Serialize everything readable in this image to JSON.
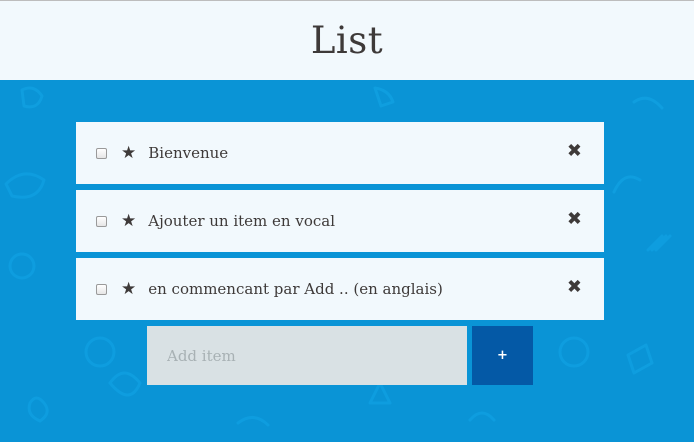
{
  "header": {
    "title": "List"
  },
  "items": [
    {
      "label": "Bienvenue",
      "checked": false,
      "starred": true,
      "remove_icon": "close-icon"
    },
    {
      "label": "Ajouter un item en vocal",
      "checked": false,
      "starred": true,
      "remove_icon": "close-icon"
    },
    {
      "label": "en commencant par Add .. (en anglais)",
      "checked": false,
      "starred": true,
      "remove_icon": "close-icon"
    }
  ],
  "add_form": {
    "placeholder": "Add item",
    "button_label": "+"
  },
  "glyphs": {
    "star": "★",
    "remove": "✖"
  },
  "colors": {
    "background": "#0a94d6",
    "header_bg": "#f2f9fd",
    "item_bg": "#f2f9fd",
    "input_bg": "#d9e1e4",
    "button_bg": "#0459a6",
    "text": "#3e3a39"
  }
}
